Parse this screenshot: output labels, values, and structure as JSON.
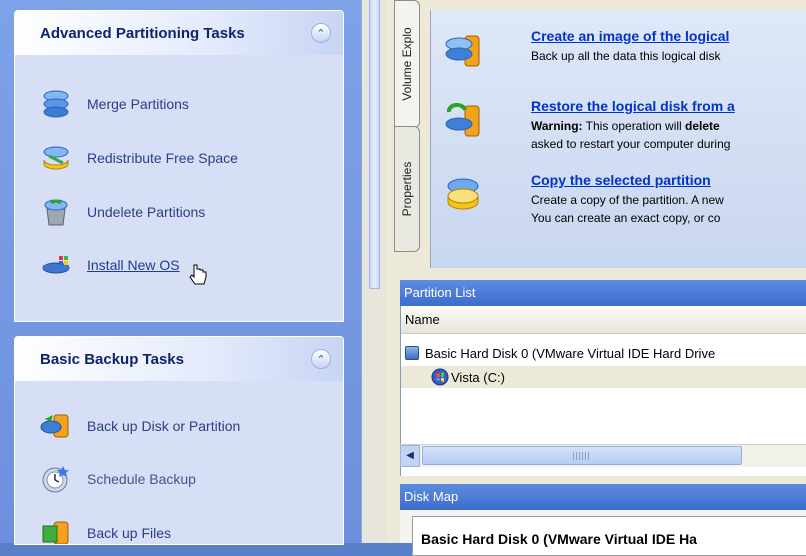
{
  "advanced_panel": {
    "title": "Advanced Partitioning Tasks",
    "collapse_glyph": "»",
    "tasks": [
      {
        "label": "Merge Partitions",
        "icon": "merge-partitions-icon"
      },
      {
        "label": "Redistribute Free Space",
        "icon": "redistribute-space-icon"
      },
      {
        "label": "Undelete Partitions",
        "icon": "undelete-partitions-icon"
      },
      {
        "label": "Install New OS",
        "icon": "install-os-icon"
      }
    ]
  },
  "backup_panel": {
    "title": "Basic Backup Tasks",
    "collapse_glyph": "»",
    "tasks": [
      {
        "label": "Back up Disk or Partition",
        "icon": "backup-disk-icon"
      },
      {
        "label": "Schedule Backup",
        "icon": "schedule-backup-icon"
      },
      {
        "label": "Back up Files",
        "icon": "backup-files-icon"
      }
    ]
  },
  "vertical_tabs": [
    "Volume Explo",
    "Properties"
  ],
  "operations": [
    {
      "title": "Create an image of the logical",
      "desc": [
        "Back up all the data this logical disk"
      ],
      "icon": "disk-image-icon"
    },
    {
      "title": "Restore the logical disk from a",
      "desc_bold": "Warning:",
      "desc_rest": " This operation will ",
      "desc_bold2": "delete",
      "desc2": "asked to restart your computer during",
      "icon": "restore-disk-icon"
    },
    {
      "title": "Copy the selected partition",
      "desc": [
        "Create a copy of the partition. A new",
        "You can create an exact copy, or co"
      ],
      "icon": "copy-partition-icon"
    }
  ],
  "partition_list": {
    "title": "Partition List",
    "column": "Name",
    "disk": "Basic Hard Disk 0 (VMware Virtual IDE Hard Drive",
    "volume": "Vista (C:)"
  },
  "disk_map": {
    "title": "Disk Map",
    "disk_label": "Basic Hard Disk 0 (VMware Virtual IDE Ha"
  },
  "colors": {
    "task_pane_bg": "#7ea2e8",
    "panel_bg": "#d6dff5",
    "panel_title": "#10246b",
    "link_blue": "#0033cc",
    "header_bar": "#4a7ad6"
  }
}
